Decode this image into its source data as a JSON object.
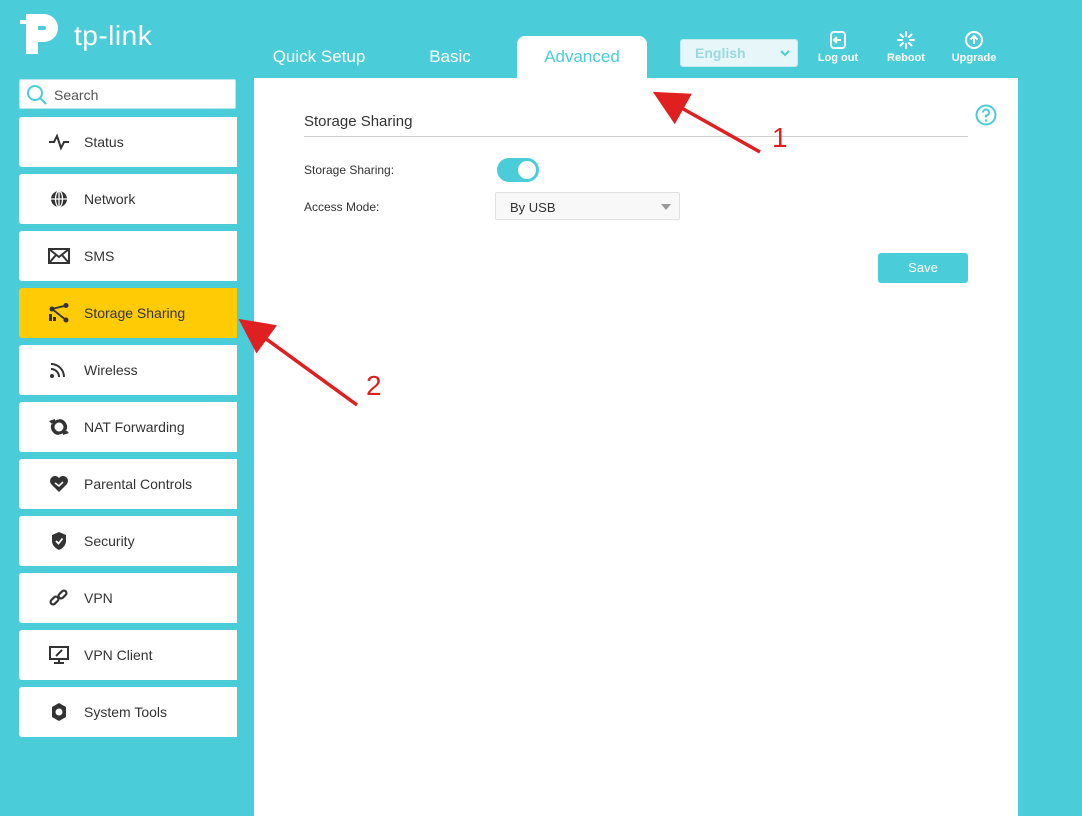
{
  "brand": {
    "logo_text": "tp-link"
  },
  "tabs": [
    {
      "label": "Quick Setup"
    },
    {
      "label": "Basic"
    },
    {
      "label": "Advanced",
      "active": true
    }
  ],
  "header": {
    "language": "English",
    "logout_label": "Log out",
    "reboot_label": "Reboot",
    "upgrade_label": "Upgrade"
  },
  "search": {
    "placeholder": "Search"
  },
  "sidebar": {
    "items": [
      {
        "label": "Status",
        "icon": "pulse-icon"
      },
      {
        "label": "Network",
        "icon": "globe-icon"
      },
      {
        "label": "SMS",
        "icon": "envelope-icon"
      },
      {
        "label": "Storage Sharing",
        "icon": "share-icon",
        "active": true
      },
      {
        "label": "Wireless",
        "icon": "wifi-icon"
      },
      {
        "label": "NAT Forwarding",
        "icon": "nat-icon"
      },
      {
        "label": "Parental Controls",
        "icon": "heart-icon"
      },
      {
        "label": "Security",
        "icon": "shield-icon"
      },
      {
        "label": "VPN",
        "icon": "link-icon"
      },
      {
        "label": "VPN Client",
        "icon": "monitor-icon"
      },
      {
        "label": "System Tools",
        "icon": "gear-icon"
      }
    ]
  },
  "main": {
    "section_title": "Storage Sharing",
    "storage_sharing_label": "Storage Sharing:",
    "storage_sharing_enabled": true,
    "access_mode_label": "Access Mode:",
    "access_mode_value": "By USB",
    "save_label": "Save"
  },
  "annotations": {
    "arrow1": "1",
    "arrow2": "2"
  },
  "colors": {
    "accent": "#4acdd8",
    "active_item": "#ffcb05",
    "annotation": "#e02020"
  }
}
